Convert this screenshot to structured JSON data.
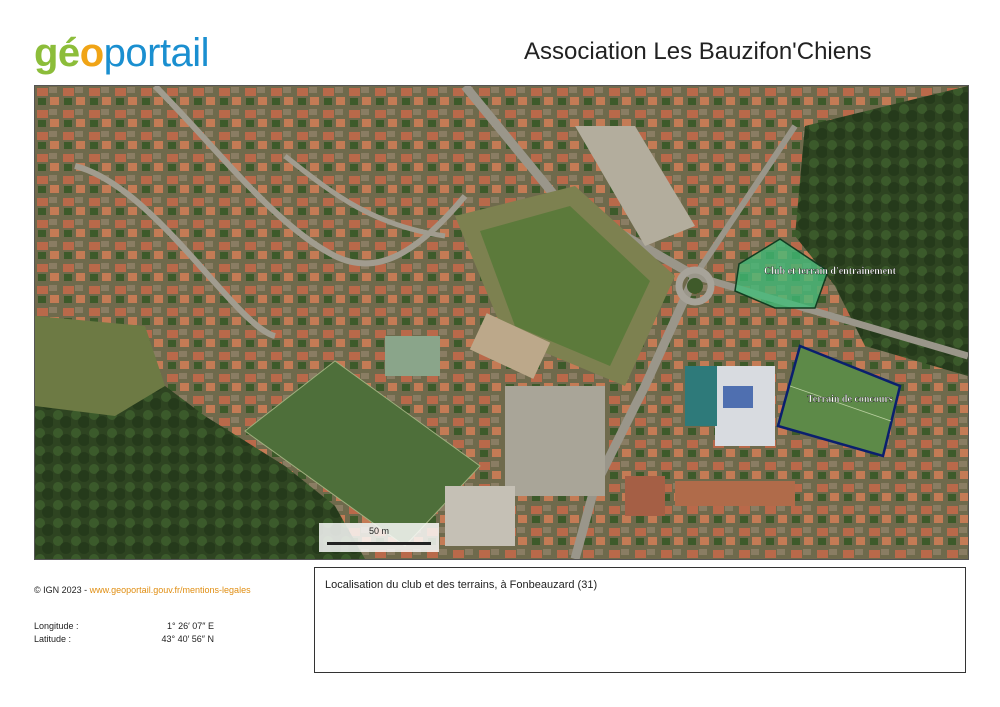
{
  "header": {
    "logo": {
      "part1": "gé",
      "part2": "o",
      "part3": "portail"
    },
    "title": "Association Les Bauzifon'Chiens"
  },
  "map": {
    "labels": {
      "club": "Club et terrain d'entrainement",
      "concours": "Terrain de concours"
    },
    "scale_label": "50 m",
    "colors": {
      "club_fill": "#3fbf7a",
      "concours_stroke": "#0a1f6e",
      "vegetation": "#2f4a22"
    }
  },
  "footer": {
    "copyright_prefix": "© IGN 2023 - ",
    "copyright_link": "www.geoportail.gouv.fr/mentions-legales",
    "longitude_label": "Longitude :",
    "longitude_value": "1° 26′ 07″ E",
    "latitude_label": "Latitude :",
    "latitude_value": "43° 40′ 56″ N",
    "caption": "Localisation du club et des terrains, à Fonbeauzard (31)"
  }
}
